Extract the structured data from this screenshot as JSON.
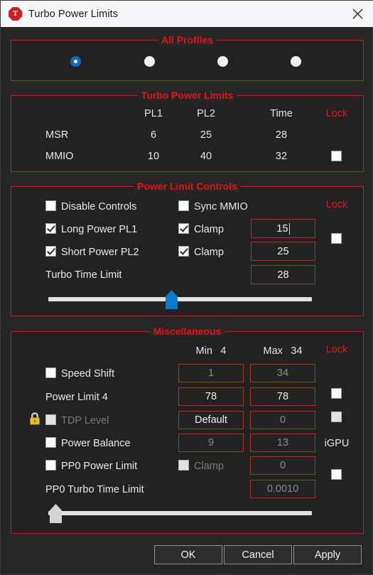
{
  "window": {
    "title": "Turbo Power Limits",
    "app_icon": "turbo-octagon-icon",
    "icon_letter": "T",
    "close_label": "✕",
    "accent_red": "#e01616",
    "border_red": "#bb2222",
    "input_border": "#a03a28",
    "bg": "#262626",
    "group_bg": "#222222",
    "blue": "#0a6fc2"
  },
  "all_profiles": {
    "title": "All Profiles",
    "radios": [
      {
        "selected": true
      },
      {
        "selected": false
      },
      {
        "selected": false
      },
      {
        "selected": false
      }
    ]
  },
  "turbo_power_limits": {
    "title": "Turbo Power Limits",
    "columns": [
      "PL1",
      "PL2",
      "Time",
      "Lock"
    ],
    "rows": [
      {
        "name": "MSR",
        "pl1": "6",
        "pl2": "25",
        "time": "28",
        "lock": null
      },
      {
        "name": "MMIO",
        "pl1": "10",
        "pl2": "40",
        "time": "32",
        "lock": false
      }
    ]
  },
  "power_limit_controls": {
    "title": "Power Limit Controls",
    "lock_header": "Lock",
    "rows": [
      {
        "label": "Disable Controls",
        "checked": false,
        "second_label": "Sync MMIO",
        "second_checked": false,
        "value": null
      },
      {
        "label": "Long Power PL1",
        "checked": true,
        "second_label": "Clamp",
        "second_checked": true,
        "value": "15",
        "focused": true
      },
      {
        "label": "Short Power PL2",
        "checked": true,
        "second_label": "Clamp",
        "second_checked": true,
        "value": "25"
      },
      {
        "label": "Turbo Time Limit",
        "checked": null,
        "second_label": null,
        "second_checked": null,
        "value": "28"
      }
    ],
    "lock_checked": false,
    "slider": {
      "value_pct": 46
    }
  },
  "miscellaneous": {
    "title": "Miscellaneous",
    "min_header": "Min",
    "min_value": "4",
    "max_header": "Max",
    "max_value": "34",
    "lock_header": "Lock",
    "igpu_label": "iGPU",
    "rows": [
      {
        "label": "Speed Shift",
        "checkbox": false,
        "disabled_label": false,
        "min": "1",
        "max": "34",
        "min_dim": true,
        "max_dim": true,
        "lock": null,
        "lock_disabled": false,
        "lock_icon": false
      },
      {
        "label": "Power Limit 4",
        "checkbox": null,
        "disabled_label": false,
        "min": "78",
        "max": "78",
        "min_dim": false,
        "max_dim": false,
        "lock": false,
        "lock_disabled": false,
        "lock_icon": false
      },
      {
        "label": "TDP Level",
        "checkbox": false,
        "disabled_label": true,
        "min": "Default",
        "max": "0",
        "min_dim": false,
        "max_dim": true,
        "lock": false,
        "lock_disabled": true,
        "lock_icon": true
      },
      {
        "label": "Power Balance",
        "checkbox": false,
        "disabled_label": false,
        "min": "9",
        "max": "13",
        "min_dim": true,
        "max_dim": true,
        "lock": null,
        "lock_disabled": false,
        "lock_icon": false
      },
      {
        "label": "PP0 Power Limit",
        "checkbox": false,
        "disabled_label": false,
        "clamp_label": "Clamp",
        "clamp_checked": false,
        "clamp_disabled": true,
        "max": "0",
        "max_dim": true,
        "lock": false,
        "lock_disabled": false,
        "lock_icon": false
      },
      {
        "label": "PP0 Turbo Time Limit",
        "checkbox": null,
        "disabled_label": false,
        "max": "0.0010",
        "max_dim": true,
        "lock": null,
        "lock_disabled": false,
        "lock_icon": false
      }
    ],
    "slider": {
      "value_pct": 1
    }
  },
  "buttons": {
    "ok": "OK",
    "cancel": "Cancel",
    "apply": "Apply"
  }
}
